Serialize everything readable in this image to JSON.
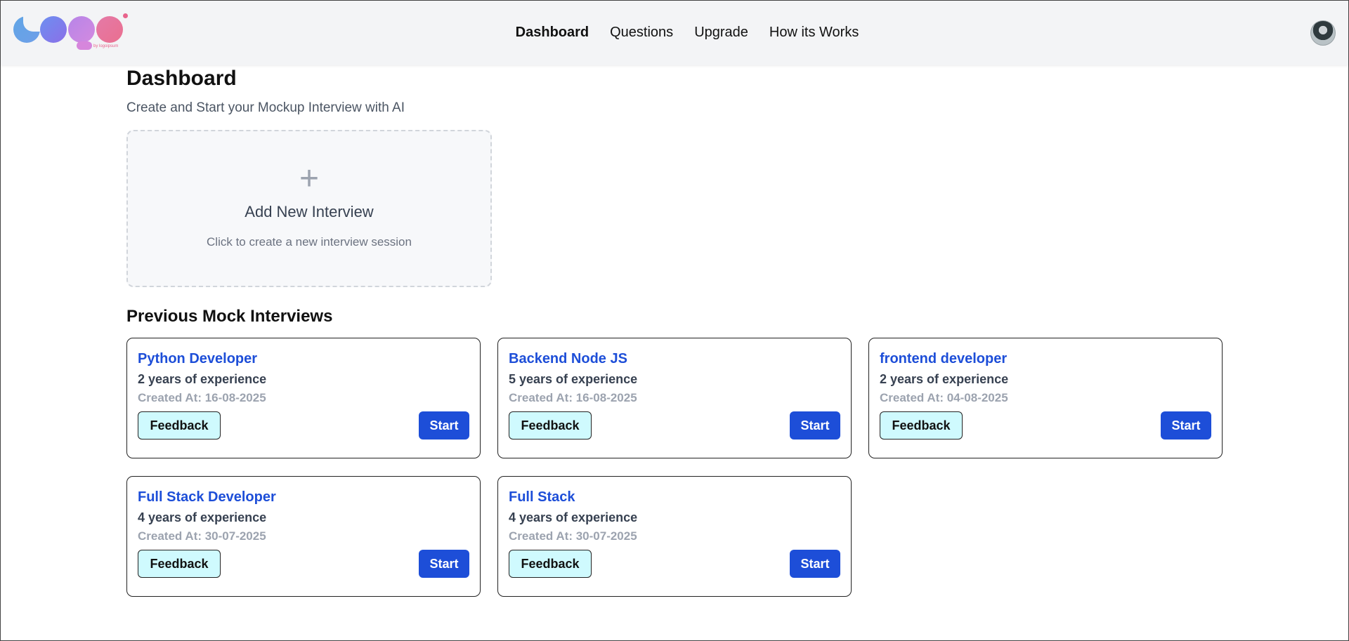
{
  "header": {
    "logo": {
      "tagline": "by logoipsum",
      "icon": "logo-icon",
      "brand_colors": [
        "#60a5e6",
        "#8b6fe8",
        "#d38ae0",
        "#ea6f8f"
      ]
    },
    "nav": [
      {
        "label": "Dashboard",
        "active": true
      },
      {
        "label": "Questions",
        "active": false
      },
      {
        "label": "Upgrade",
        "active": false
      },
      {
        "label": "How its Works",
        "active": false
      }
    ],
    "avatar_icon": "user-avatar"
  },
  "main": {
    "title": "Dashboard",
    "subtitle": "Create and Start your Mockup Interview with AI",
    "add_card": {
      "icon": "plus-icon",
      "icon_glyph": "+",
      "title": "Add New Interview",
      "hint": "Click to create a new interview session"
    },
    "section_title": "Previous Mock Interviews",
    "interviews": [
      {
        "role": "Python Developer",
        "experience": "2 years of experience",
        "created": "Created At: 16-08-2025",
        "feedback_label": "Feedback",
        "start_label": "Start"
      },
      {
        "role": "Backend Node JS",
        "experience": "5 years of experience",
        "created": "Created At: 16-08-2025",
        "feedback_label": "Feedback",
        "start_label": "Start"
      },
      {
        "role": "frontend developer",
        "experience": "2 years of experience",
        "created": "Created At: 04-08-2025",
        "feedback_label": "Feedback",
        "start_label": "Start"
      },
      {
        "role": "Full Stack Developer",
        "experience": "4 years of experience",
        "created": "Created At: 30-07-2025",
        "feedback_label": "Feedback",
        "start_label": "Start"
      },
      {
        "role": "Full Stack",
        "experience": "4 years of experience",
        "created": "Created At: 30-07-2025",
        "feedback_label": "Feedback",
        "start_label": "Start"
      }
    ]
  },
  "colors": {
    "accent": "#1d4ed8",
    "feedback_bg": "#cffafe",
    "header_bg": "#f3f4f6"
  }
}
